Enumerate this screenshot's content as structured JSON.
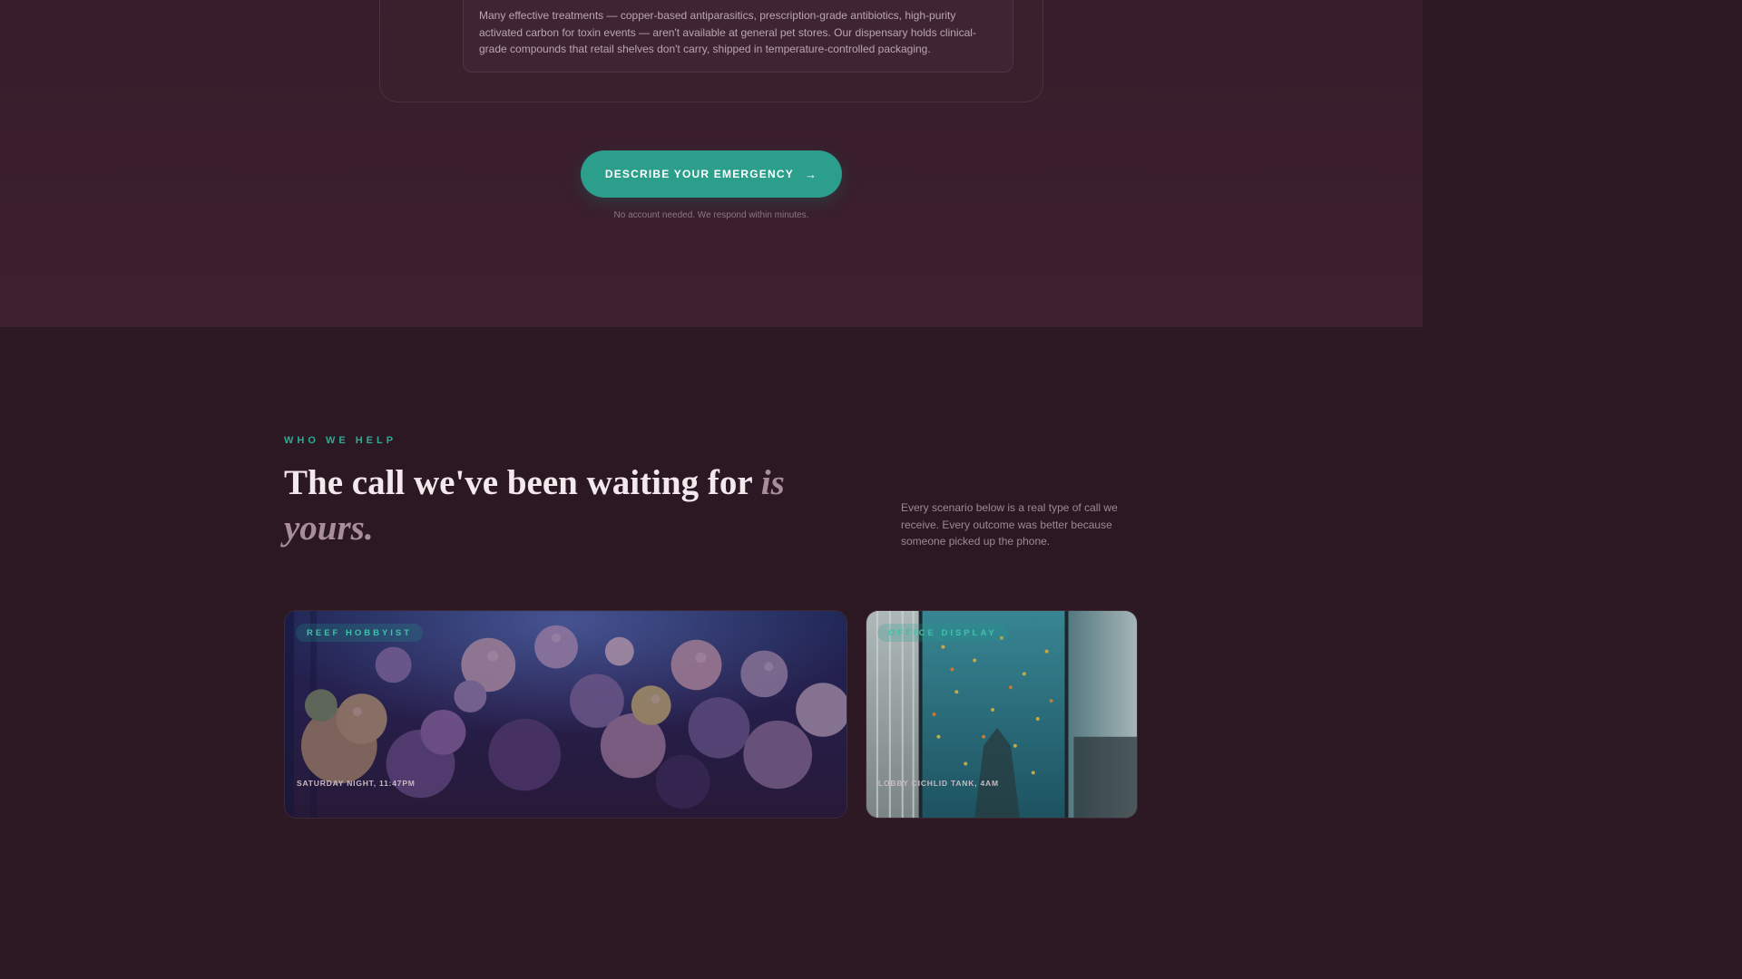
{
  "treatment_note": {
    "text": "Many effective treatments — copper-based antiparasitics, prescription-grade antibiotics, high-purity activated carbon for toxin events — aren't available at general pet stores. Our dispensary holds clinical-grade compounds that retail shelves don't carry, shipped in temperature-controlled packaging."
  },
  "cta": {
    "label": "DESCRIBE YOUR EMERGENCY",
    "arrow": "→",
    "note": "No account needed. We respond within minutes."
  },
  "who_we_help": {
    "eyebrow": "WHO WE HELP",
    "headline_main": "The call we've been waiting for ",
    "headline_accent": "is yours.",
    "intro": "Every scenario below is a real type of call we receive. Every outcome was better because someone picked up the phone."
  },
  "cards": [
    {
      "tag": "REEF HOBBYIST",
      "caption": "SATURDAY NIGHT, 11:47PM",
      "image": "coral-reef-aquarium"
    },
    {
      "tag": "OFFICE DISPLAY",
      "caption": "LOBBY CICHLID TANK, 4AM",
      "image": "office-lobby-aquarium"
    }
  ],
  "colors": {
    "accent": "#2b9e8c",
    "eyebrow": "#2faa94",
    "background_top": "#3d2030",
    "background_bottom": "#2b1823"
  }
}
